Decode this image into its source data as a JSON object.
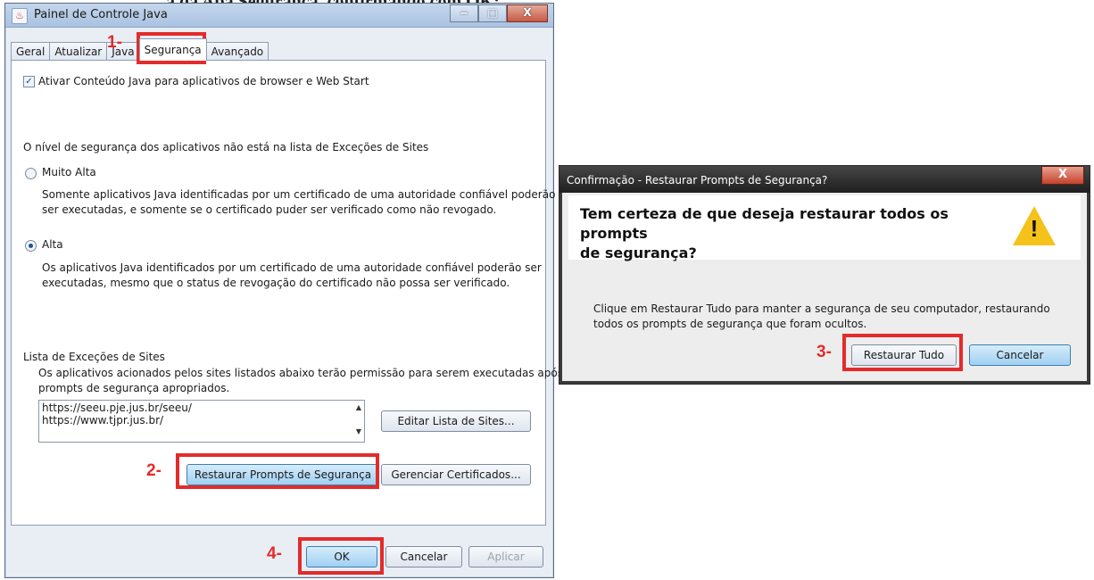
{
  "background_caption": "a da Aba Segurança, confirmando com OK:",
  "java_window": {
    "app_icon": "java-icon",
    "title": "Painel de Controle Java",
    "controls": {
      "minimize": "‒",
      "maximize": "□",
      "close": "X"
    },
    "tabs": [
      "Geral",
      "Atualizar",
      "Java",
      "Segurança",
      "Avançado"
    ],
    "active_tab": "Segurança",
    "enable_java_label": "Ativar Conteúdo Java para aplicativos de browser e Web Start",
    "enable_java_checked": true,
    "security_level_heading": "O nível de segurança dos aplicativos não está na lista de Exceções de Sites",
    "levels": [
      {
        "label": "Muito Alta",
        "selected": false,
        "desc_line1": "Somente aplicativos Java identificadas por um certificado de uma autoridade confiável poderão",
        "desc_line2": "ser executadas, e somente se o certificado puder ser verificado como não revogado."
      },
      {
        "label": "Alta",
        "selected": true,
        "desc_line1": "Os aplicativos Java identificados por um certificado de uma autoridade confiável poderão ser",
        "desc_line2": "executadas, mesmo que o status de revogação do certificado não possa ser verificado."
      }
    ],
    "exception_list": {
      "heading": "Lista de Exceções de Sites",
      "desc_line1": "Os aplicativos acionados pelos sites listados abaixo terão permissão para serem executadas após os",
      "desc_line2": "prompts de segurança apropriados.",
      "sites": [
        "https://seeu.pje.jus.br/seeu/",
        "https://www.tjpr.jus.br/"
      ],
      "edit_button": "Editar Lista de Sites..."
    },
    "restore_prompts_button": "Restaurar Prompts de Segurança",
    "manage_certs_button": "Gerenciar Certificados...",
    "footer": {
      "ok": "OK",
      "cancel": "Cancelar",
      "apply": "Aplicar"
    }
  },
  "confirm_dialog": {
    "title": "Confirmação - Restaurar Prompts de Segurança?",
    "close": "X",
    "question_line1": "Tem certeza de que deseja restaurar todos os prompts",
    "question_line2": "de segurança?",
    "warning_icon": "warning-icon",
    "body": "Clique em Restaurar Tudo para manter a segurança de seu computador, restaurando todos os prompts de segurança que foram ocultos.",
    "restore_all_button": "Restaurar Tudo",
    "cancel_button": "Cancelar"
  },
  "annotations": {
    "step1": "1-",
    "step2": "2-",
    "step3": "3-",
    "step4": "4-"
  },
  "colors": {
    "highlight": "#e32b2b",
    "warning": "#f4c21b",
    "primary_button": "#9fd0f2"
  }
}
